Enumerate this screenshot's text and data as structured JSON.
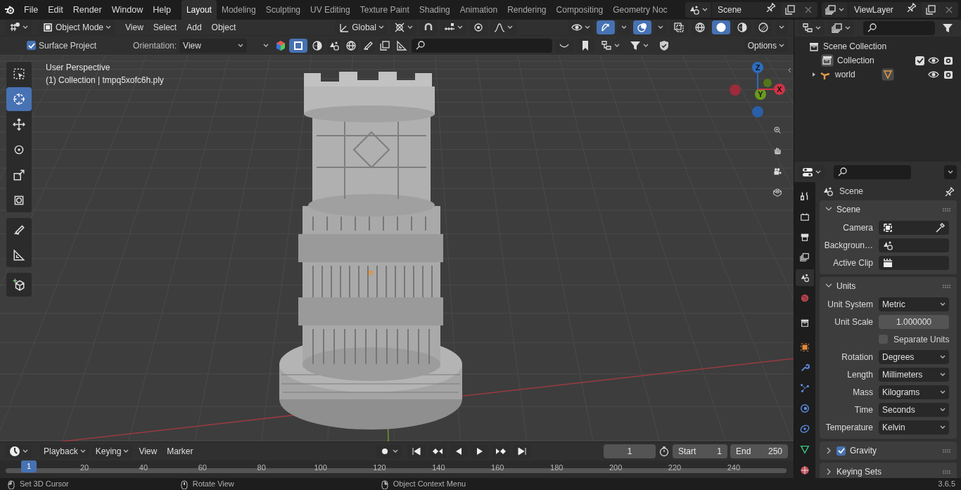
{
  "menu": [
    "File",
    "Edit",
    "Render",
    "Window",
    "Help"
  ],
  "workspaces": [
    {
      "label": "Layout",
      "selected": true
    },
    {
      "label": "Modeling",
      "selected": false
    },
    {
      "label": "Sculpting",
      "selected": false
    },
    {
      "label": "UV Editing",
      "selected": false
    },
    {
      "label": "Texture Paint",
      "selected": false
    },
    {
      "label": "Shading",
      "selected": false
    },
    {
      "label": "Animation",
      "selected": false
    },
    {
      "label": "Rendering",
      "selected": false
    },
    {
      "label": "Compositing",
      "selected": false
    },
    {
      "label": "Geometry Noc",
      "selected": false
    }
  ],
  "scene_selector": {
    "value": "Scene"
  },
  "view_layer_selector": {
    "value": "ViewLayer"
  },
  "viewport_header": {
    "mode": "Object Mode",
    "menus": [
      "View",
      "Select",
      "Add",
      "Object"
    ],
    "orientation": "Global",
    "gizmos_on": true,
    "overlays_on": true,
    "shading": [
      {
        "selected": false
      },
      {
        "selected": true
      },
      {
        "selected": false
      },
      {
        "selected": false
      }
    ]
  },
  "tool_settings": {
    "surface_project": {
      "label": "Surface Project",
      "checked": true
    },
    "orientation_label": "Orientation:",
    "orientation": "View",
    "options": "Options"
  },
  "tool_groups": [
    [
      {
        "kind": "select_box",
        "selected": false
      },
      {
        "kind": "cursor",
        "selected": true
      },
      {
        "kind": "move",
        "selected": false
      },
      {
        "kind": "rotate",
        "selected": false
      },
      {
        "kind": "scale",
        "selected": false
      },
      {
        "kind": "transform",
        "selected": false
      }
    ],
    [
      {
        "kind": "annotate",
        "selected": false
      },
      {
        "kind": "measure",
        "selected": false
      }
    ],
    [
      {
        "kind": "add_cube",
        "selected": false
      }
    ]
  ],
  "viewport": {
    "info": [
      "User Perspective",
      "(1) Collection | tmpq5xofc6h.ply"
    ],
    "axes": [
      {
        "label": "Z"
      },
      {
        "label": "Y"
      },
      {
        "label": "X"
      }
    ]
  },
  "outliner": {
    "root": {
      "label": "Scene Collection",
      "children": [
        {
          "label": "Collection",
          "kind": "collection",
          "checked": true
        },
        {
          "label": "world",
          "kind": "object",
          "expanded": false
        }
      ]
    }
  },
  "properties": {
    "context": "Scene",
    "tabs": [
      {
        "kind": "tool",
        "selected": false
      },
      {
        "kind": "render",
        "selected": false
      },
      {
        "kind": "output",
        "selected": false
      },
      {
        "kind": "view_layer",
        "selected": false
      },
      {
        "kind": "scene",
        "selected": true
      },
      {
        "kind": "world",
        "selected": false
      },
      {
        "kind": "collection",
        "selected": false
      },
      {
        "kind": "object",
        "selected": false
      },
      {
        "kind": "modifiers",
        "selected": false
      },
      {
        "kind": "particles",
        "selected": false
      },
      {
        "kind": "physics",
        "selected": false
      },
      {
        "kind": "constraints",
        "selected": false
      },
      {
        "kind": "data",
        "selected": false
      },
      {
        "kind": "material",
        "selected": false
      }
    ],
    "panels": [
      {
        "title": "Scene",
        "expanded": true,
        "rows": [
          {
            "label": "Camera",
            "kind": "camera_picker"
          },
          {
            "label": "Backgroun…",
            "kind": "scene_picker"
          },
          {
            "label": "Active Clip",
            "kind": "clip_picker"
          }
        ]
      },
      {
        "title": "Units",
        "expanded": true,
        "rows": [
          {
            "label": "Unit System",
            "kind": "dropdown",
            "value": "Metric"
          },
          {
            "label": "Unit Scale",
            "kind": "number",
            "value": "1.000000"
          },
          {
            "label": "Separate Units",
            "kind": "checkbox",
            "checked": false
          },
          {
            "label": "Rotation",
            "kind": "dropdown",
            "value": "Degrees"
          },
          {
            "label": "Length",
            "kind": "dropdown",
            "value": "Millimeters"
          },
          {
            "label": "Mass",
            "kind": "dropdown",
            "value": "Kilograms"
          },
          {
            "label": "Time",
            "kind": "dropdown",
            "value": "Seconds"
          },
          {
            "label": "Temperature",
            "kind": "dropdown",
            "value": "Kelvin"
          }
        ]
      },
      {
        "title": "Gravity",
        "expanded": false,
        "checked": true
      },
      {
        "title": "Keying Sets",
        "expanded": false
      }
    ]
  },
  "timeline": {
    "menus": [
      "Playback",
      "Keying",
      "View",
      "Marker"
    ],
    "current_frame": "1",
    "start_label": "Start",
    "start": "1",
    "end_label": "End",
    "end": "250",
    "playhead": "1",
    "ticks": [
      "20",
      "40",
      "60",
      "80",
      "100",
      "120",
      "140",
      "160",
      "180",
      "200",
      "220",
      "240"
    ]
  },
  "status_bar": {
    "hints": [
      "Set 3D Cursor",
      "Rotate View",
      "Object Context Menu"
    ],
    "version": "3.6.5"
  }
}
